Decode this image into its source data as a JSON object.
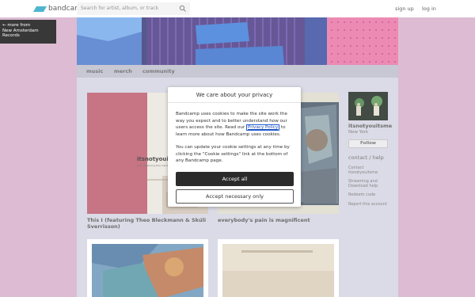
{
  "header": {
    "logo_text": "bandcamp",
    "search_placeholder": "Search for artist, album, or track",
    "signup_label": "sign up",
    "login_label": "log in"
  },
  "back_badge": {
    "lines": [
      "← more from",
      "New Amsterdam",
      "Records"
    ]
  },
  "nav": {
    "items": [
      "music",
      "merch",
      "community"
    ]
  },
  "albums": [
    {
      "title_line1": "This I (featuring Theo Bleckmann & Skúli",
      "title_line2": "Sverrisson)",
      "cover_text": "itsnotyouitsme",
      "cover_subtext": "this i (featuring theo bleckmann & skúli sverrisson)"
    },
    {
      "title_line1": "everybody's pain is magnificent"
    }
  ],
  "artist": {
    "name": "itsnotyouitsme",
    "location": "New York",
    "follow_label": "Follow",
    "contact_heading": "contact / help",
    "links": [
      "Contact",
      "itsnotyouitsme",
      "Streaming and",
      "Download help",
      "Redeem code",
      "Report this account"
    ]
  },
  "cookie_dialog": {
    "title": "We care about your privacy",
    "para1_before": "Bandcamp uses cookies to make the site work the way you expect and to better understand how our users access the site. Read our ",
    "policy_link": "Privacy Policy",
    "para1_after": " to learn more about how Bandcamp uses cookies.",
    "para2": "You can update your cookie settings at any time by clicking the \"Cookie settings\" link at the bottom of any Bandcamp page.",
    "accept_all": "Accept all",
    "accept_necessary": "Accept necessary only"
  },
  "colors": {
    "page_background": "#d4a8c7",
    "content_background": "#d1d1e0",
    "logo_accent": "#1da0c3",
    "accept_button": "#2b2b2b",
    "policy_link": "#1e4fb5"
  }
}
